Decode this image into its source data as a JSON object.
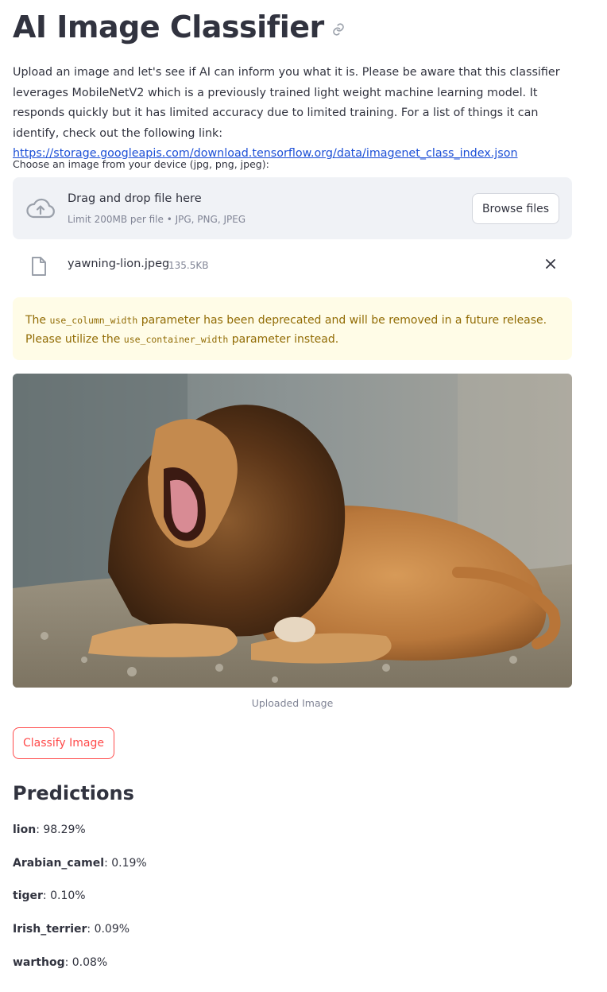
{
  "header": {
    "title": "AI Image Classifier"
  },
  "intro": {
    "text": "Upload an image and let's see if AI can inform you what it is. Please be aware that this classifier leverages MobileNetV2 which is a previously trained light weight machine learning model. It responds quickly but it has limited accuracy due to limited training. For a list of things it can identify, check out the following link:",
    "link": "https://storage.googleapis.com/download.tensorflow.org/data/imagenet_class_index.json"
  },
  "uploader": {
    "label": "Choose an image from your device (jpg, png, jpeg):",
    "drop_title": "Drag and drop file here",
    "drop_subtitle": "Limit 200MB per file • JPG, PNG, JPEG",
    "browse_label": "Browse files",
    "file_name": "yawning-lion.jpeg",
    "file_size": "135.5KB"
  },
  "warning": {
    "part1": "The ",
    "code1": "use_column_width",
    "part2": " parameter has been deprecated and will be removed in a future release. Please utilize the ",
    "code2": "use_container_width",
    "part3": " parameter instead."
  },
  "image": {
    "caption": "Uploaded Image"
  },
  "actions": {
    "classify_label": "Classify Image"
  },
  "predictions": {
    "title": "Predictions",
    "items": [
      {
        "label": "lion",
        "value": ": 98.29%"
      },
      {
        "label": "Arabian_camel",
        "value": ": 0.19%"
      },
      {
        "label": "tiger",
        "value": ": 0.10%"
      },
      {
        "label": "Irish_terrier",
        "value": ": 0.09%"
      },
      {
        "label": "warthog",
        "value": ": 0.08%"
      }
    ]
  },
  "colors": {
    "accent": "#ff4b4b",
    "text": "#31333f",
    "link": "#1c4fd6",
    "warning_bg": "#fffce7",
    "warning_text": "#926c05"
  }
}
